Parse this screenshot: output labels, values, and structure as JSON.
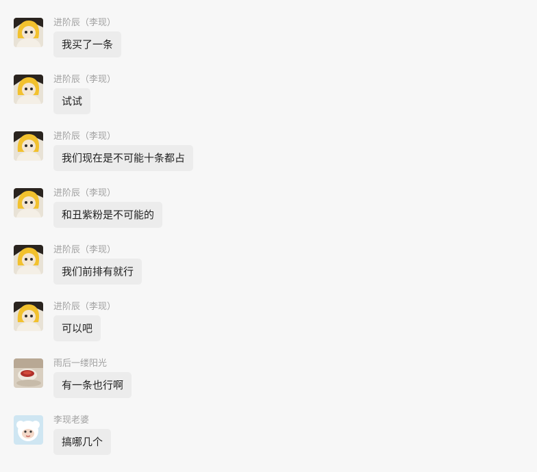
{
  "messages": [
    {
      "sender": "进阶辰（李现）",
      "text": "我买了一条",
      "avatar": "yellow-hood-avatar"
    },
    {
      "sender": "进阶辰（李现）",
      "text": "试试",
      "avatar": "yellow-hood-avatar"
    },
    {
      "sender": "进阶辰（李现）",
      "text": "我们现在是不可能十条都占",
      "avatar": "yellow-hood-avatar"
    },
    {
      "sender": "进阶辰（李现）",
      "text": "和丑紫粉是不可能的",
      "avatar": "yellow-hood-avatar"
    },
    {
      "sender": "进阶辰（李现）",
      "text": "我们前排有就行",
      "avatar": "yellow-hood-avatar"
    },
    {
      "sender": "进阶辰（李现）",
      "text": "可以吧",
      "avatar": "yellow-hood-avatar"
    },
    {
      "sender": "雨后一缕阳光",
      "text": "有一条也行啊",
      "avatar": "tea-cup-avatar"
    },
    {
      "sender": "李现老婆",
      "text": "搞哪几个",
      "avatar": "white-sheep-avatar"
    }
  ]
}
